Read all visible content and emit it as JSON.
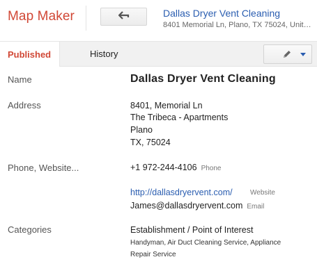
{
  "header": {
    "brand": "Map Maker",
    "place_title": "Dallas Dryer Vent Cleaning",
    "place_subtitle": "8401 Memorial Ln, Plano, TX 75024, Unite..."
  },
  "tabs": {
    "published": "Published",
    "history": "History"
  },
  "details": {
    "name_label": "Name",
    "name_value": "Dallas Dryer Vent Cleaning",
    "address_label": "Address",
    "address_lines": [
      "8401, Memorial Ln",
      "The Tribeca - Apartments",
      "Plano",
      "TX, 75024"
    ],
    "phone_label": "Phone, Website...",
    "phone_value": "+1 972-244-4106",
    "phone_tag": "Phone",
    "website_value": "http://dallasdryervent.com/",
    "website_tag": "Website",
    "email_value": "James@dallasdryervent.com",
    "email_tag": "Email",
    "categories_label": "Categories",
    "categories_primary": "Establishment / Point of Interest",
    "categories_secondary_line1": "Handyman, Air Duct Cleaning Service, Appliance",
    "categories_secondary_line2": "Repair Service"
  },
  "colors": {
    "brand": "#d14836",
    "link": "#2a5db0"
  },
  "icons": {
    "back": "arrow-left-icon",
    "edit": "pencil-icon",
    "dropdown": "caret-down-icon"
  }
}
